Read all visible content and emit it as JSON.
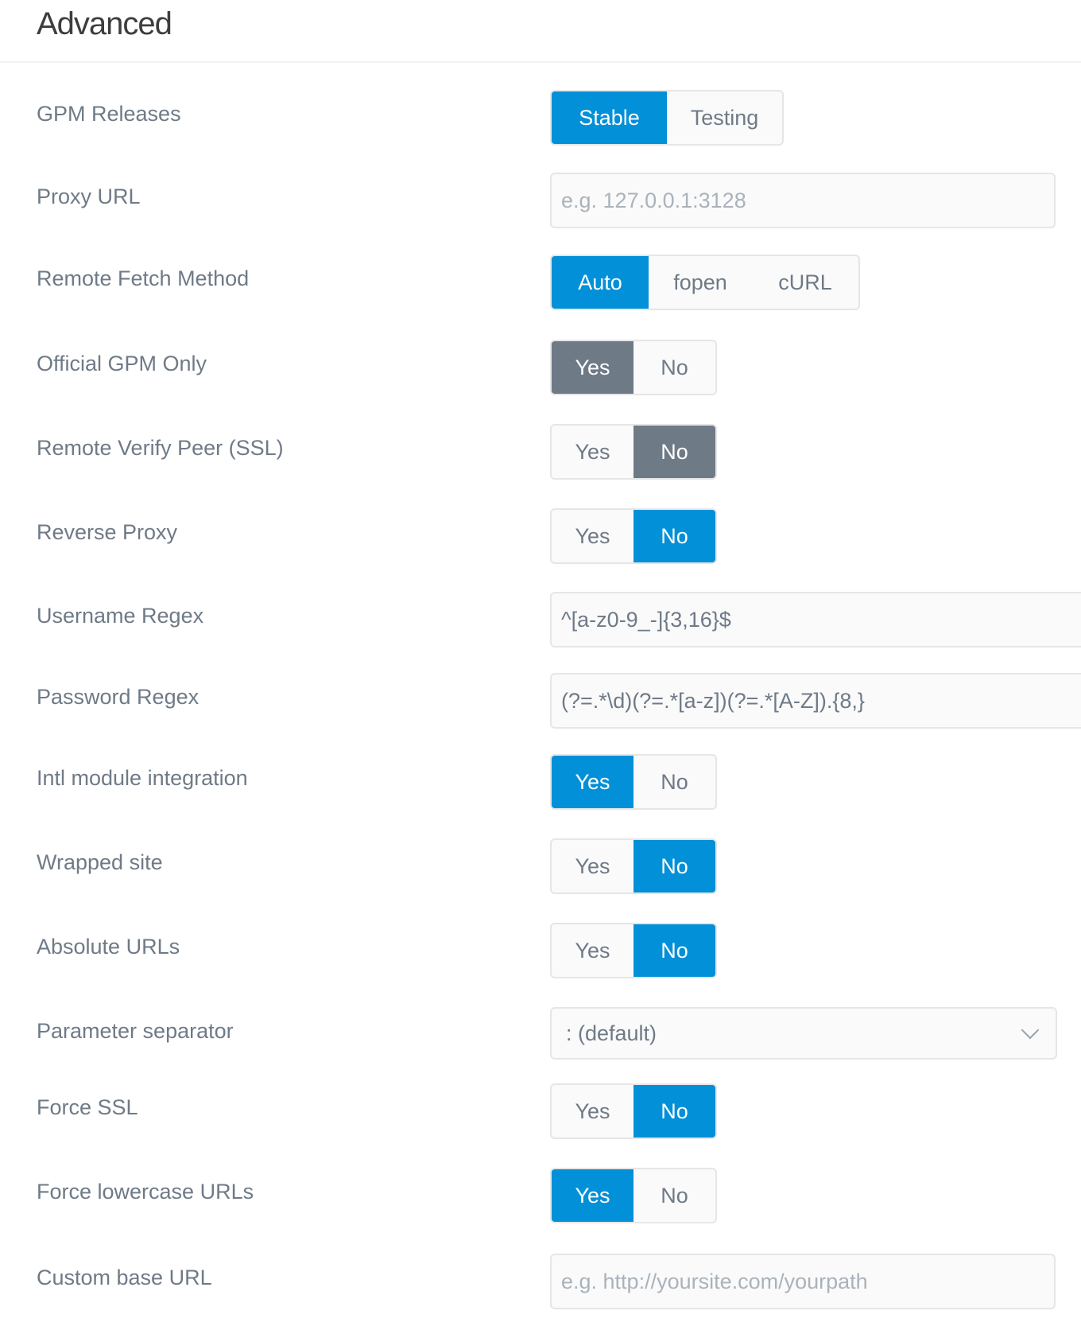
{
  "header": {
    "title": "Advanced"
  },
  "colors": {
    "accent": "#0290d8",
    "neutral_active": "#6f7a87",
    "label": "#6f7a87",
    "field_bg": "#fafafa",
    "border": "#e6e6e6"
  },
  "settings": {
    "gpm_releases": {
      "label": "GPM Releases",
      "options": [
        "Stable",
        "Testing"
      ],
      "selected": "Stable"
    },
    "proxy_url": {
      "label": "Proxy URL",
      "value": "",
      "placeholder": "e.g. 127.0.0.1:3128"
    },
    "remote_fetch_method": {
      "label": "Remote Fetch Method",
      "options": [
        "Auto",
        "fopen",
        "cURL"
      ],
      "selected": "Auto"
    },
    "official_gpm_only": {
      "label": "Official GPM Only",
      "options": [
        "Yes",
        "No"
      ],
      "selected": "Yes"
    },
    "remote_verify_peer": {
      "label": "Remote Verify Peer (SSL)",
      "options": [
        "Yes",
        "No"
      ],
      "selected": "No"
    },
    "reverse_proxy": {
      "label": "Reverse Proxy",
      "options": [
        "Yes",
        "No"
      ],
      "selected": "No"
    },
    "username_regex": {
      "label": "Username Regex",
      "value": "^[a-z0-9_-]{3,16}$"
    },
    "password_regex": {
      "label": "Password Regex",
      "value": "(?=.*\\d)(?=.*[a-z])(?=.*[A-Z]).{8,}"
    },
    "intl_module": {
      "label": "Intl module integration",
      "options": [
        "Yes",
        "No"
      ],
      "selected": "Yes"
    },
    "wrapped_site": {
      "label": "Wrapped site",
      "options": [
        "Yes",
        "No"
      ],
      "selected": "No"
    },
    "absolute_urls": {
      "label": "Absolute URLs",
      "options": [
        "Yes",
        "No"
      ],
      "selected": "No"
    },
    "parameter_separator": {
      "label": "Parameter separator",
      "selected": ": (default)",
      "icon": "chevron-down-icon"
    },
    "force_ssl": {
      "label": "Force SSL",
      "options": [
        "Yes",
        "No"
      ],
      "selected": "No"
    },
    "force_lowercase_urls": {
      "label": "Force lowercase URLs",
      "options": [
        "Yes",
        "No"
      ],
      "selected": "Yes"
    },
    "custom_base_url": {
      "label": "Custom base URL",
      "value": "",
      "placeholder": "e.g. http://yoursite.com/yourpath"
    }
  }
}
